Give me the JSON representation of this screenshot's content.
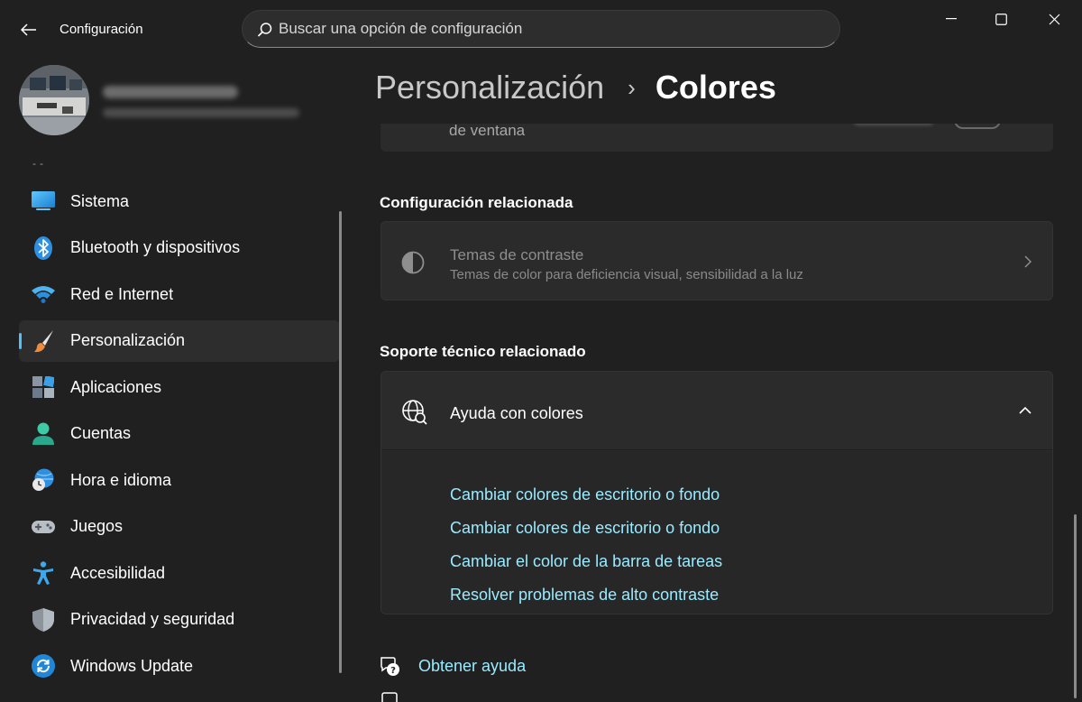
{
  "window": {
    "app_title": "Configuración",
    "controls": [
      "minimize-icon",
      "maximize-icon",
      "close-icon"
    ]
  },
  "search": {
    "placeholder": "Buscar una opción de configuración"
  },
  "sidebar": {
    "items": [
      {
        "label": "Sistema",
        "icon": "system-icon"
      },
      {
        "label": "Bluetooth y dispositivos",
        "icon": "bluetooth-icon"
      },
      {
        "label": "Red e Internet",
        "icon": "wifi-icon"
      },
      {
        "label": "Personalización",
        "icon": "brush-icon",
        "selected": true
      },
      {
        "label": "Aplicaciones",
        "icon": "apps-icon"
      },
      {
        "label": "Cuentas",
        "icon": "account-icon"
      },
      {
        "label": "Hora e idioma",
        "icon": "time-language-icon"
      },
      {
        "label": "Juegos",
        "icon": "gamepad-icon"
      },
      {
        "label": "Accesibilidad",
        "icon": "accessibility-icon"
      },
      {
        "label": "Privacidad y seguridad",
        "icon": "shield-icon"
      },
      {
        "label": "Windows Update",
        "icon": "update-icon"
      }
    ]
  },
  "header": {
    "parent": "Personalización",
    "separator": "›",
    "current": "Colores"
  },
  "partial_card": {
    "text": "de ventana"
  },
  "related_settings": {
    "title": "Configuración relacionada",
    "contrast_title": "Temas de contraste",
    "contrast_desc": "Temas de color para deficiencia visual, sensibilidad a la luz"
  },
  "related_support": {
    "title": "Soporte técnico relacionado",
    "help_title": "Ayuda con colores",
    "links": [
      "Cambiar colores de escritorio o fondo",
      "Cambiar colores de escritorio o fondo",
      "Cambiar el color de la barra de tareas",
      "Resolver problemas de alto contraste"
    ]
  },
  "bottom": {
    "get_help": "Obtener ayuda"
  },
  "colors": {
    "background": "#202020",
    "card": "#2b2b2b",
    "accent": "#4cc2ff",
    "link": "#99ebff"
  }
}
